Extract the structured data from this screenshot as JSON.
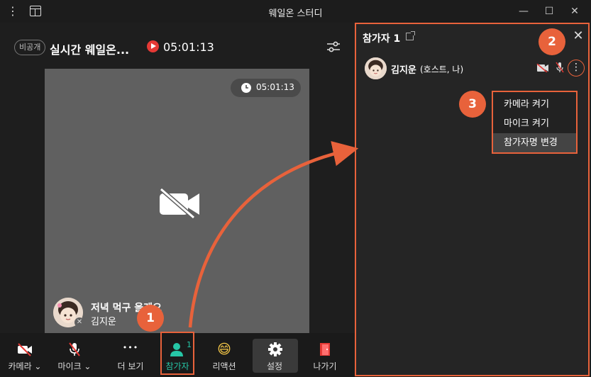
{
  "window": {
    "title": "웨일온 스터디",
    "minimize_glyph": "—",
    "maximize_glyph": "☐",
    "close_glyph": "✕",
    "menu_glyph": "⋮"
  },
  "header": {
    "visibility_badge": "비공개",
    "room_title": "실시간 웨일온...",
    "elapsed_time": "05:01:13"
  },
  "video_tile": {
    "clock_time": "05:01:13",
    "status_message": "저녁 먹구 올게요",
    "participant_name": "김지운",
    "camera": "off"
  },
  "toolbar": {
    "camera_label": "카메라 ⌄",
    "mic_label": "마이크 ⌄",
    "more_label": "더 보기",
    "more_glyph": "•••",
    "participants_label": "참가자",
    "participants_count": "1",
    "reaction_label": "리액션",
    "reaction_glyph": "😄",
    "settings_label": "설정",
    "leave_label": "나가기"
  },
  "participants_panel": {
    "title": "참가자 1",
    "close_glyph": "✕",
    "participant": {
      "name": "김지운",
      "role": "(호스트, 나)",
      "more_glyph": "⋮"
    },
    "menu": [
      {
        "label": "카메라 켜기"
      },
      {
        "label": "마이크 켜기"
      },
      {
        "label": "참가자명 변경"
      }
    ]
  },
  "steps": [
    "1",
    "2",
    "3"
  ],
  "colors": {
    "accent_callout": "#e8623b",
    "active_teal": "#26c6a6",
    "live_red": "#e53935",
    "video_bg": "#606060",
    "panel_bg": "#252525"
  }
}
